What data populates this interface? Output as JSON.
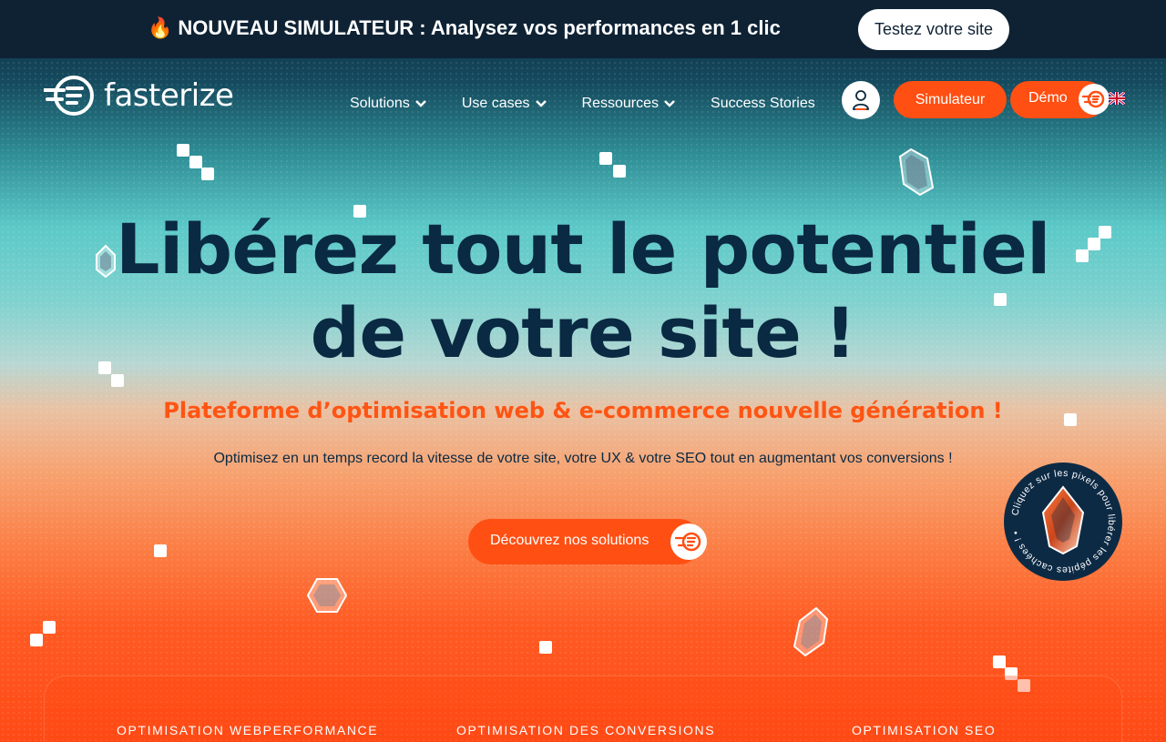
{
  "promo": {
    "fire_icon": "fire-emoji",
    "text": "NOUVEAU SIMULATEUR : Analysez vos performances en 1 clic",
    "button": "Testez votre site"
  },
  "header": {
    "logo": "fasterize",
    "nav": [
      {
        "label": "Solutions",
        "has_dropdown": true
      },
      {
        "label": "Use cases",
        "has_dropdown": true
      },
      {
        "label": "Ressources",
        "has_dropdown": true
      },
      {
        "label": "Success Stories",
        "has_dropdown": false
      }
    ],
    "user_icon": "user-icon",
    "simulator_button": "Simulateur",
    "demo_button": "Démo",
    "language_icon": "uk-flag-icon"
  },
  "hero": {
    "title_line1": "Libérez tout le potentiel",
    "title_line2": "de votre site !",
    "subtitle": "Plateforme d’optimisation web & e-commerce nouvelle génération !",
    "description": "Optimisez en un temps record la vitesse de votre site, votre UX & votre SEO tout en augmentant vos conversions !",
    "cta": "Découvrez nos solutions"
  },
  "badge": {
    "text": "Cliquez sur les pixels pour libérer les pépites cachées ! •"
  },
  "features": [
    "OPTIMISATION WEBPERFORMANCE",
    "OPTIMISATION DES CONVERSIONS",
    "OPTIMISATION SEO"
  ],
  "colors": {
    "brand_orange": "#ff4f12",
    "brand_navy": "#0a2942",
    "promo_bg": "#0e2234"
  }
}
